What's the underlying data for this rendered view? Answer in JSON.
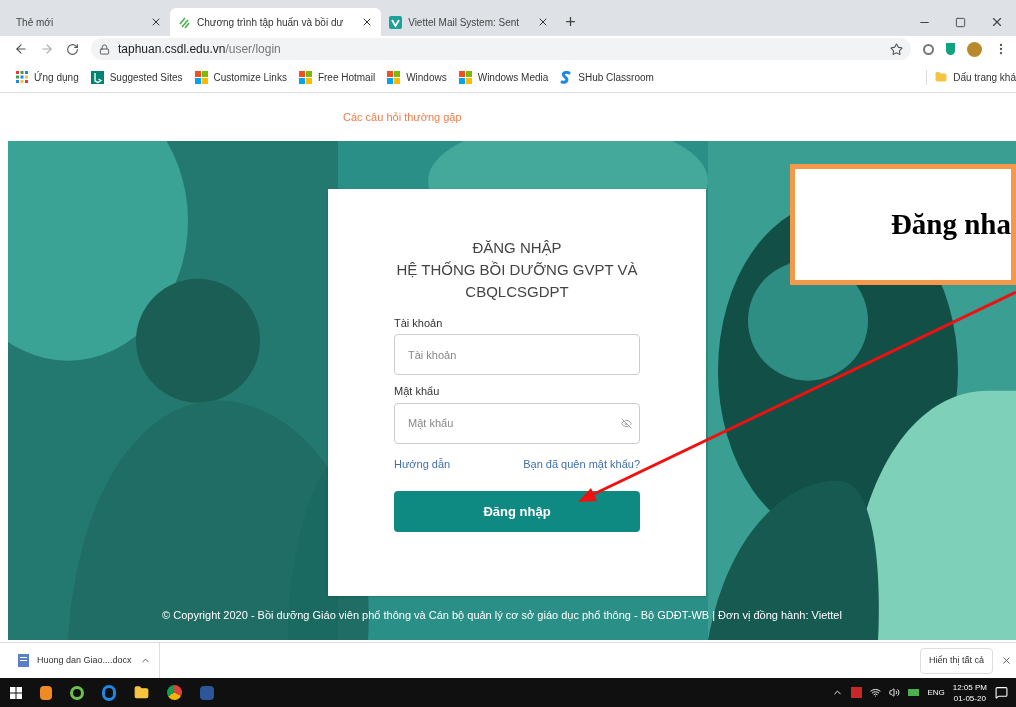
{
  "tabs": [
    {
      "title": "Thẻ mới",
      "kind": "blank",
      "selected": false
    },
    {
      "title": "Chương trình tập huấn và bồi dư",
      "kind": "leaf",
      "selected": true
    },
    {
      "title": "Viettel Mail System: Sent",
      "kind": "mail",
      "selected": false
    }
  ],
  "new_tab": "+",
  "address_bar": {
    "domain": "taphuan.csdl.edu.vn",
    "path": "/user/login"
  },
  "bookmarks": [
    {
      "label": "Ứng dụng",
      "kind": "apps"
    },
    {
      "label": "Suggested Sites",
      "kind": "bing"
    },
    {
      "label": "Customize Links",
      "kind": "windows"
    },
    {
      "label": "Free Hotmail",
      "kind": "windows"
    },
    {
      "label": "Windows",
      "kind": "windows"
    },
    {
      "label": "Windows Media",
      "kind": "windows"
    },
    {
      "label": "SHub Classroom",
      "kind": "shub"
    }
  ],
  "other_bookmarks": "Dấu trang khá",
  "faq_link": "Các câu hỏi thường gặp",
  "login": {
    "title": "ĐĂNG NHẬP",
    "subtitle": "HỆ THỐNG BỒI DƯỠNG GVPT VÀ CBQLCSGDPT",
    "fields": [
      {
        "label": "Tài khoản",
        "placeholder": "Tài khoản",
        "kind": "text"
      },
      {
        "label": "Mật khẩu",
        "placeholder": "Mật khẩu",
        "kind": "password"
      }
    ],
    "help_link": "Hướng dẫn",
    "forgot_link": "Bạn đã quên mật khẩu?",
    "submit": "Đăng nhập"
  },
  "copyright": "© Copyright 2020 - Bồi dưỡng Giáo viên phổ thông và Cán bộ quản lý cơ sở giáo dục phổ thông - Bộ GDĐT-WB | Đơn vị đồng hành: Viettel",
  "callout": {
    "text": "Đăng nha"
  },
  "download": {
    "file": "Huong dan Giao....docx",
    "show_all": "Hiển thị tất cả"
  },
  "taskbar": {
    "language": "ENG",
    "time": "12:05 PM",
    "date": "01-05-20"
  }
}
